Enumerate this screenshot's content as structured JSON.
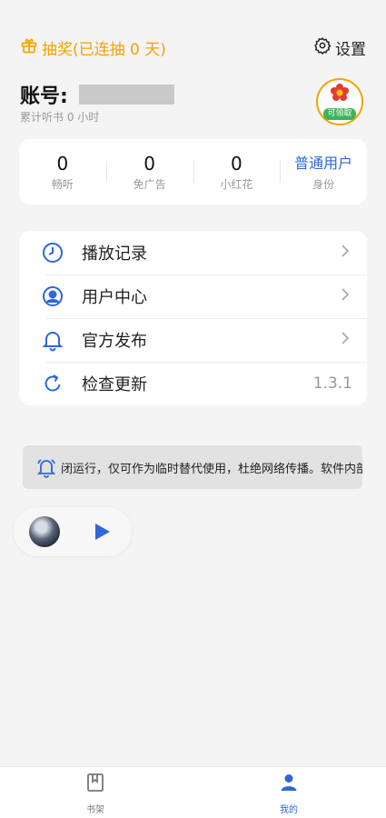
{
  "header": {
    "lottery_label": "抽奖(已连抽 0 天)",
    "settings_label": "设置"
  },
  "account": {
    "label": "账号:",
    "listen_time": "累计听书 0 小时",
    "claim_label": "可领取"
  },
  "stats": [
    {
      "value": "0",
      "label": "畅听"
    },
    {
      "value": "0",
      "label": "免广告"
    },
    {
      "value": "0",
      "label": "小红花"
    },
    {
      "value": "普通用户",
      "label": "身份"
    }
  ],
  "menu": {
    "items": [
      {
        "label": "播放记录",
        "icon": "clock-icon"
      },
      {
        "label": "用户中心",
        "icon": "user-icon"
      },
      {
        "label": "官方发布",
        "icon": "bell-icon"
      },
      {
        "label": "检查更新",
        "icon": "refresh-icon",
        "version": "1.3.1"
      }
    ]
  },
  "notice": {
    "text": "闭运行，仅可作为临时替代使用，杜绝网络传播。软件内部"
  },
  "tabbar": {
    "tabs": [
      {
        "label": "书架",
        "icon": "bookshelf-icon"
      },
      {
        "label": "我的",
        "icon": "profile-icon"
      }
    ]
  },
  "colors": {
    "accent_orange": "#f5a300",
    "accent_blue": "#2f66d8",
    "badge_green": "#3db35a",
    "flower_red": "#e23b30"
  }
}
